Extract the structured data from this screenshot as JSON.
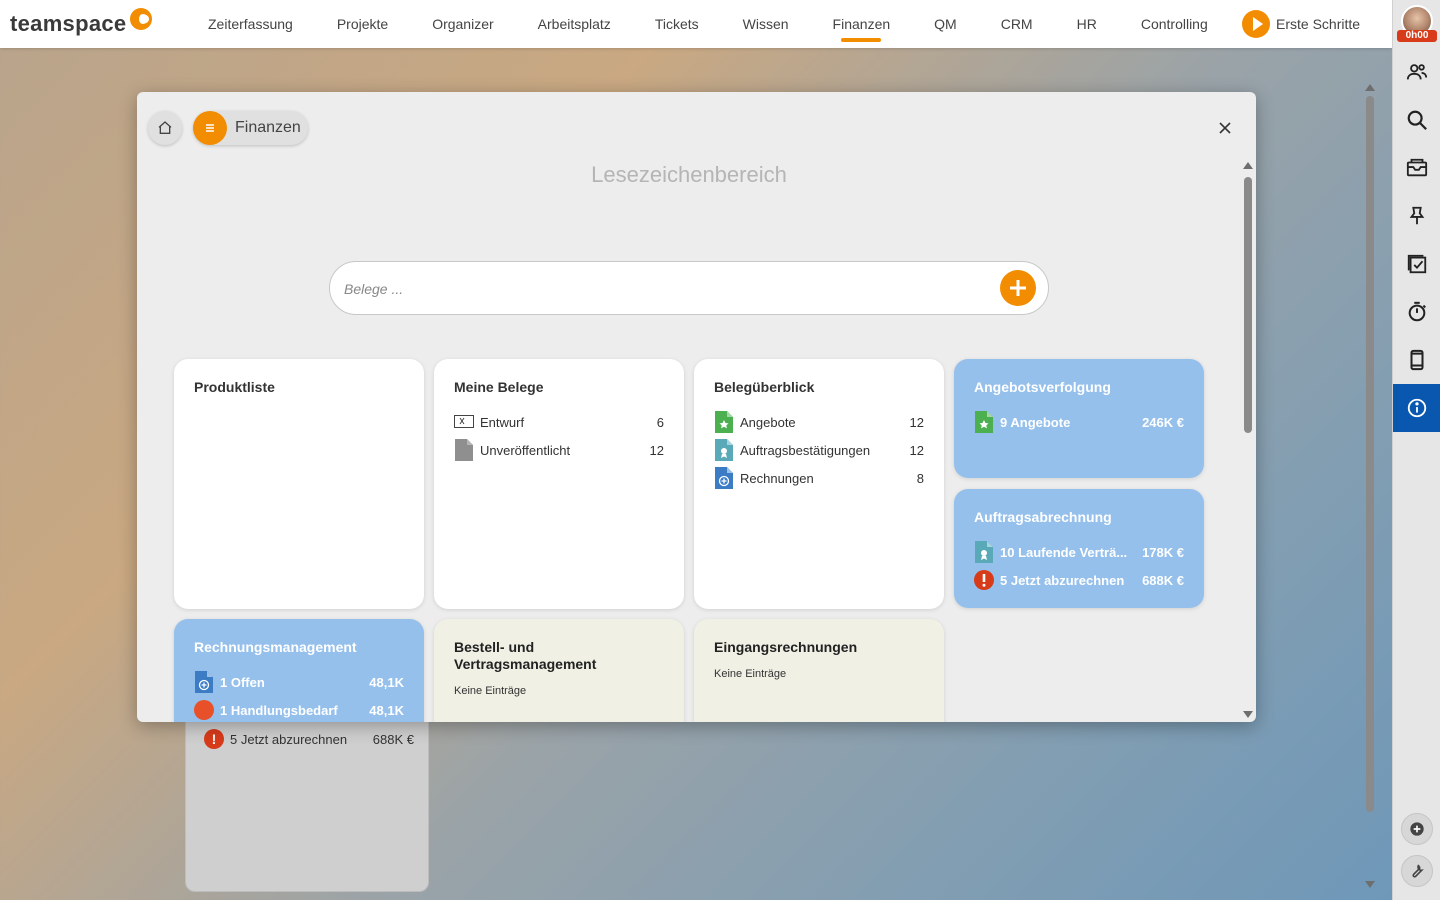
{
  "brand": {
    "name": "teamspace"
  },
  "nav": {
    "items": [
      {
        "label": "Zeiterfassung"
      },
      {
        "label": "Projekte"
      },
      {
        "label": "Organizer"
      },
      {
        "label": "Arbeitsplatz"
      },
      {
        "label": "Tickets"
      },
      {
        "label": "Wissen"
      },
      {
        "label": "Finanzen",
        "active": true
      },
      {
        "label": "QM"
      },
      {
        "label": "CRM"
      },
      {
        "label": "HR"
      },
      {
        "label": "Controlling"
      }
    ],
    "first_steps": "Erste Schritte"
  },
  "user": {
    "time": "0h00"
  },
  "sidebar_icons": [
    "users-icon",
    "search-icon",
    "inbox-icon",
    "pin-icon",
    "tasks-icon",
    "stopwatch-icon",
    "mobile-icon",
    "info-icon",
    "add-circle-icon",
    "wrench-icon"
  ],
  "colors": {
    "accent": "#f28c00",
    "active_sidebar": "#0a57b0",
    "card_blue": "#95c0ec",
    "card_beige": "#f0f0e5",
    "alert": "#d83b1a"
  },
  "modal": {
    "breadcrumb": "Finanzen",
    "title": "Lesezeichenbereich",
    "search_placeholder": "Belege ..."
  },
  "cards": {
    "produktliste": {
      "title": "Produktliste"
    },
    "meine_belege": {
      "title": "Meine Belege",
      "rows": [
        {
          "label": "Entwurf",
          "value": "6"
        },
        {
          "label": "Unveröffentlicht",
          "value": "12"
        }
      ]
    },
    "belegueberblick": {
      "title": "Belegüberblick",
      "rows": [
        {
          "label": "Angebote",
          "value": "12"
        },
        {
          "label": "Auftragsbestätigungen",
          "value": "12"
        },
        {
          "label": "Rechnungen",
          "value": "8"
        }
      ]
    },
    "angebotsverfolgung": {
      "title": "Angebotsverfolgung",
      "rows": [
        {
          "label": "9 Angebote",
          "value": "246K €"
        }
      ]
    },
    "auftragsabrechnung": {
      "title": "Auftragsabrechnung",
      "rows": [
        {
          "label": "10 Laufende Verträ...",
          "value": "178K €"
        },
        {
          "label": "5 Jetzt abzurechnen",
          "value": "688K €"
        }
      ]
    },
    "rechnungsmanagement": {
      "title": "Rechnungsmanagement",
      "rows": [
        {
          "label": "1 Offen",
          "value": "48,1K"
        },
        {
          "label": "1 Handlungsbedarf",
          "value": "48,1K"
        }
      ]
    },
    "bestell": {
      "title_line1": "Bestell- und",
      "title_line2": "Vertragsmanagement",
      "empty": "Keine Einträge"
    },
    "eingang": {
      "title": "Eingangsrechnungen",
      "empty": "Keine Einträge"
    }
  },
  "behind_card": {
    "row": {
      "label": "5 Jetzt abzurechnen",
      "value": "688K €"
    }
  }
}
